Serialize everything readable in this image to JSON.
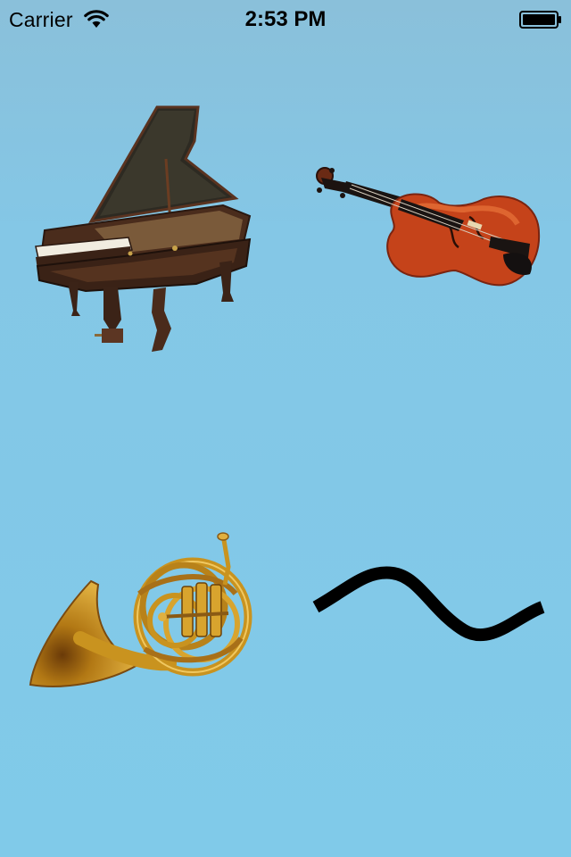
{
  "status_bar": {
    "carrier": "Carrier",
    "time": "2:53 PM"
  },
  "colors": {
    "background": "#84c7e6",
    "wood_dark": "#3a241a",
    "violin": "#c5431a",
    "brass": "#c9931f",
    "wave": "#000000"
  },
  "tiles": [
    {
      "name": "piano",
      "icon": "grand-piano-image"
    },
    {
      "name": "violin",
      "icon": "violin-image"
    },
    {
      "name": "horn",
      "icon": "french-horn-image"
    },
    {
      "name": "wave",
      "icon": "sine-wave-symbol"
    }
  ]
}
